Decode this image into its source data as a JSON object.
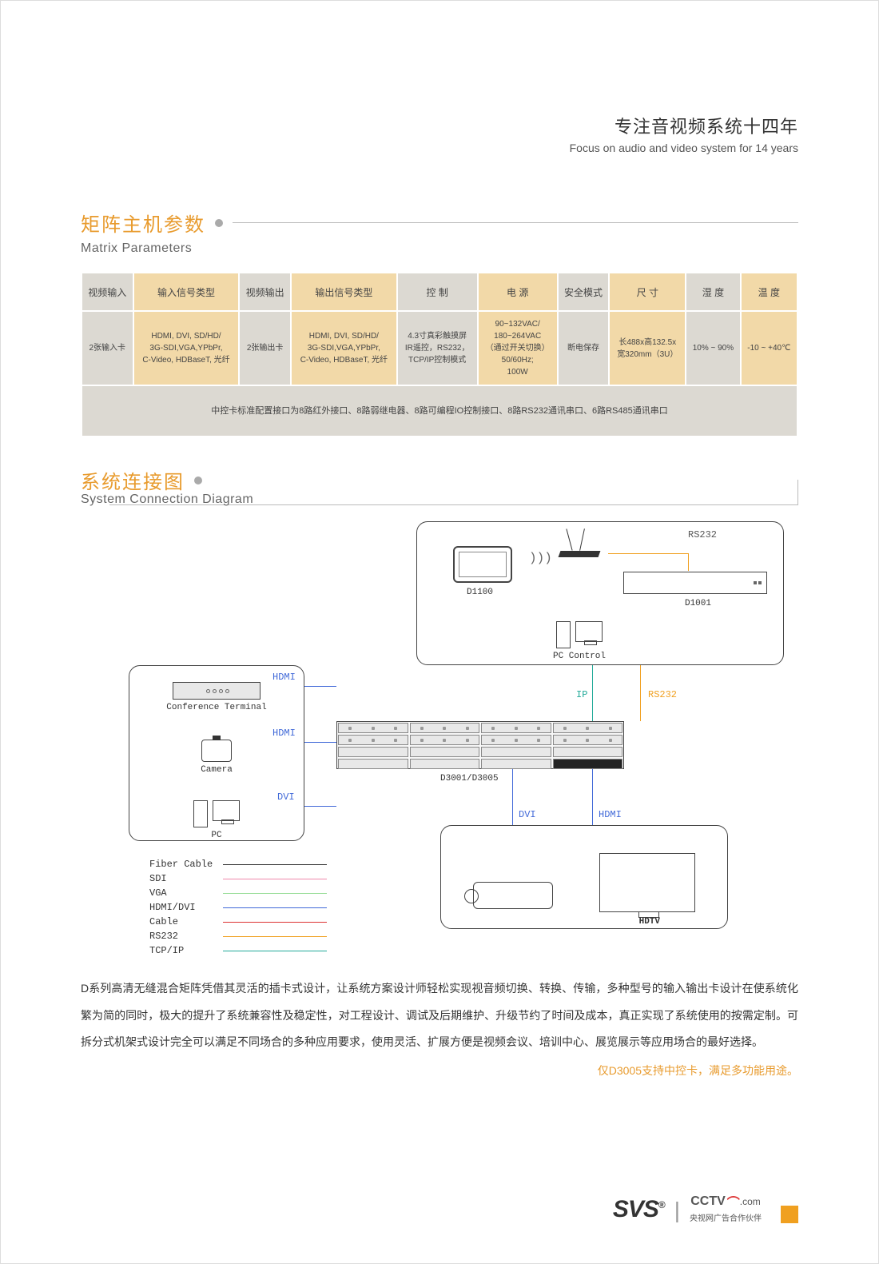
{
  "header": {
    "cn": "专注音视频系统十四年",
    "en": "Focus on audio and video system for 14 years"
  },
  "section1": {
    "title_cn": "矩阵主机参数",
    "title_en": "Matrix Parameters",
    "table": {
      "headers": [
        "视频输入",
        "输入信号类型",
        "视频输出",
        "输出信号类型",
        "控  制",
        "电  源",
        "安全模式",
        "尺  寸",
        "湿  度",
        "温  度"
      ],
      "row": [
        "2张输入卡",
        "HDMI, DVI, SD/HD/\n3G-SDI,VGA,YPbPr,\nC-Video, HDBaseT, 光纤",
        "2张输出卡",
        "HDMI, DVI, SD/HD/\n3G-SDI,VGA,YPbPr,\nC-Video, HDBaseT, 光纤",
        "4.3寸真彩触摸屏\nIR遥控，RS232，\nTCP/IP控制模式",
        "90~132VAC/\n180~264VAC\n（通过开关切换）\n50/60Hz;\n100W",
        "断电保存",
        "长488x高132.5x\n宽320mm（3U）",
        "10% ~ 90%",
        "-10 ~ +40℃"
      ],
      "note": "中控卡标准配置接口为8路红外接口、8路弱继电器、8路可编程IO控制接口、8路RS232通讯串口、6路RS485通讯串口"
    }
  },
  "section2": {
    "title_cn": "系统连接图",
    "title_en": "System Connection Diagram"
  },
  "diagram": {
    "devices": {
      "d1100": "D1100",
      "d1001": "D1001",
      "pc_control": "PC Control",
      "conference_terminal": "Conference Terminal",
      "camera": "Camera",
      "pc": "PC",
      "matrix": "D3001/D3005",
      "hdtv": "HDTV"
    },
    "conn": {
      "rs232": "RS232",
      "ip": "IP",
      "hdmi": "HDMI",
      "dvi": "DVI"
    },
    "legend": {
      "fiber": "Fiber Cable",
      "sdi": "SDI",
      "vga": "VGA",
      "hdmi": "HDMI/DVI",
      "cable": "Cable",
      "rs232": "RS232",
      "tcpip": "TCP/IP"
    }
  },
  "body_text": "D系列高清无缝混合矩阵凭借其灵活的插卡式设计，让系统方案设计师轻松实现视音频切换、转换、传输，多种型号的输入输出卡设计在使系统化繁为简的同时，极大的提升了系统兼容性及稳定性，对工程设计、调试及后期维护、升级节约了时间及成本，真正实现了系统使用的按需定制。可拆分式机架式设计完全可以满足不同场合的多种应用要求，使用灵活、扩展方便是视频会议、培训中心、展览展示等应用场合的最好选择。",
  "highlight": "仅D3005支持中控卡，满足多功能用途。",
  "footer": {
    "svs": "SVS",
    "reg": "®",
    "cctv": "CCTV",
    "cctv_suffix": ".com",
    "cctv_sub": "央视网广告合作伙伴"
  }
}
